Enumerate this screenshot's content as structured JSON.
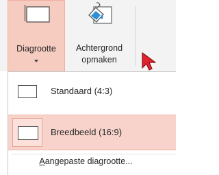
{
  "ribbon": {
    "slide_size_button": {
      "label": "Diagrootte"
    },
    "format_background_button": {
      "label_line1": "Achtergrond",
      "label_line2": "opmaken"
    }
  },
  "menu": {
    "items": [
      {
        "label": "Standaard (4:3)",
        "icon": "aspect-4-3-icon",
        "highlighted": false
      },
      {
        "label": "Breedbeeld (16:9)",
        "icon": "aspect-16-9-icon",
        "highlighted": true
      }
    ],
    "footer": {
      "access_key": "A",
      "label_rest": "angepaste diagrootte..."
    }
  },
  "colors": {
    "pressed_bg": "#f6cbc0",
    "highlight_bg": "#f8d3cb",
    "cursor": "#e0232d"
  }
}
